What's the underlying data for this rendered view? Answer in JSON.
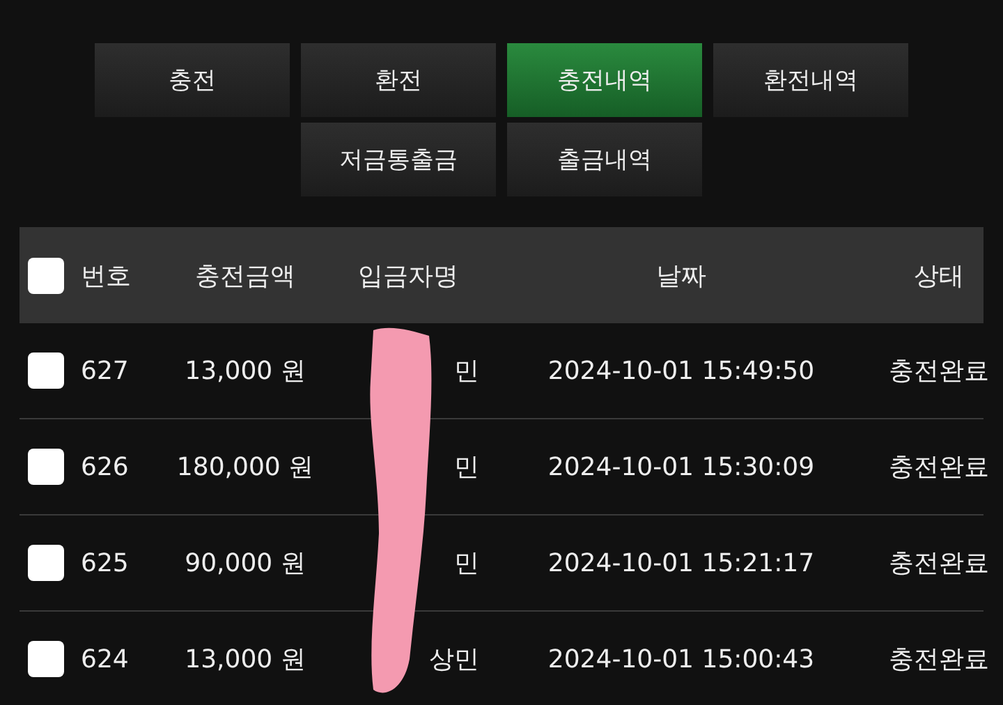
{
  "tab_rows": [
    [
      {
        "label": "충전",
        "selected": false
      },
      {
        "label": "환전",
        "selected": false
      },
      {
        "label": "충전내역",
        "selected": true
      },
      {
        "label": "환전내역",
        "selected": false
      }
    ],
    [
      {
        "label": "저금통출금",
        "selected": false
      },
      {
        "label": "출금내역",
        "selected": false
      }
    ]
  ],
  "table": {
    "select_all": {
      "checked": false
    },
    "columns": [
      "번호",
      "충전금액",
      "입금자명",
      "날짜",
      "상태"
    ],
    "rows": [
      {
        "checked": false,
        "cells": [
          "627",
          "13,000 원",
          "민",
          "2024-10-01 15:49:50",
          "충전완료"
        ]
      },
      {
        "checked": false,
        "cells": [
          "626",
          "180,000 원",
          "민",
          "2024-10-01 15:30:09",
          "충전완료"
        ]
      },
      {
        "checked": false,
        "cells": [
          "625",
          "90,000 원",
          "민",
          "2024-10-01 15:21:17",
          "충전완료"
        ]
      },
      {
        "checked": false,
        "cells": [
          "624",
          "13,000 원",
          "상민",
          "2024-10-01 15:00:43",
          "충전완료"
        ]
      }
    ]
  }
}
